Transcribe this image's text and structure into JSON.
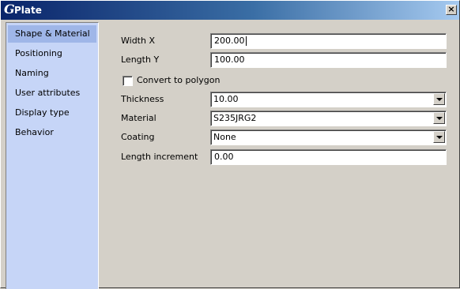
{
  "window": {
    "title": "Plate",
    "logo": "G",
    "close_glyph": "×"
  },
  "sidebar": {
    "items": [
      {
        "label": "Shape & Material",
        "selected": true
      },
      {
        "label": "Positioning",
        "selected": false
      },
      {
        "label": "Naming",
        "selected": false
      },
      {
        "label": "User attributes",
        "selected": false
      },
      {
        "label": "Display type",
        "selected": false
      },
      {
        "label": "Behavior",
        "selected": false
      }
    ]
  },
  "form": {
    "width_x": {
      "label": "Width X",
      "value": "200.00"
    },
    "length_y": {
      "label": "Length Y",
      "value": "100.00"
    },
    "convert_to_polygon": {
      "label": "Convert to polygon",
      "checked": false
    },
    "thickness": {
      "label": "Thickness",
      "value": "10.00"
    },
    "material": {
      "label": "Material",
      "value": "S235JRG2"
    },
    "coating": {
      "label": "Coating",
      "value": "None"
    },
    "length_increment": {
      "label": "Length increment",
      "value": "0.00"
    }
  },
  "icons": {
    "close": "close-icon",
    "dropdown": "chevron-down-icon",
    "logo": "app-logo-icon"
  },
  "colors": {
    "titlebar_start": "#0a246a",
    "titlebar_end": "#a6caf0",
    "sidebar_bg": "#c6d5f7",
    "sidebar_selected": "#9fb6e8",
    "window_bg": "#d4d0c8"
  }
}
